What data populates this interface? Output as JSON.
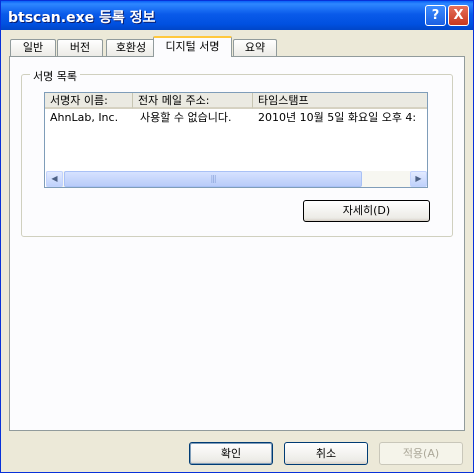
{
  "window": {
    "title": "btscan.exe 등록 정보",
    "help_glyph": "?",
    "close_glyph": "X"
  },
  "tabs": [
    {
      "label": "일반",
      "active": false
    },
    {
      "label": "버전",
      "active": false
    },
    {
      "label": "호환성",
      "active": false
    },
    {
      "label": "디지털 서명",
      "active": true
    },
    {
      "label": "요약",
      "active": false
    }
  ],
  "signature_list": {
    "group_label": "서명 목록",
    "columns": [
      "서명자 이름:",
      "전자 메일 주소:",
      "타임스탬프"
    ],
    "rows": [
      [
        "AhnLab, Inc.",
        "사용할 수 없습니다.",
        "2010년 10월 5일 화요일 오후 4:"
      ]
    ],
    "details_button": "자세히(D)",
    "scroll_left_glyph": "◀",
    "scroll_right_glyph": "▶",
    "scroll_grip": "|||"
  },
  "footer": {
    "ok_label": "확인",
    "cancel_label": "취소",
    "apply_label": "적용(A)"
  },
  "colors": {
    "titlebar": "#0A5BEA",
    "active_tab_highlight": "#FFC83C",
    "dialog_bg": "#ECE9D8"
  }
}
